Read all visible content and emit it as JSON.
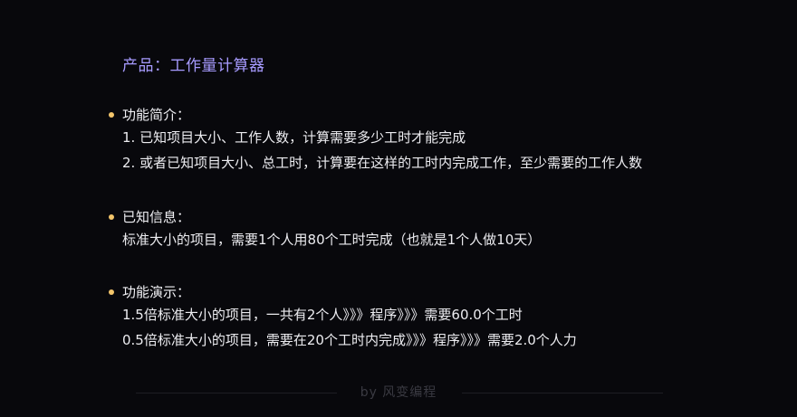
{
  "title": "产品：工作量计算器",
  "sections": [
    {
      "heading": "功能简介：",
      "lines": [
        "1. 已知项目大小、工作人数，计算需要多少工时才能完成",
        "2. 或者已知项目大小、总工时，计算要在这样的工时内完成工作，至少需要的工作人数"
      ]
    },
    {
      "heading": "已知信息：",
      "lines": [
        "标准大小的项目，需要1个人用80个工时完成（也就是1个人做10天）"
      ]
    },
    {
      "heading": "功能演示：",
      "lines": [
        "1.5倍标准大小的项目，一共有2个人》》》程序》》》需要60.0个工时",
        "0.5倍标准大小的项目，需要在20个工时内完成》》》程序》》》需要2.0个人力"
      ]
    }
  ],
  "footer": "by 风变编程",
  "colors": {
    "background": "#08080c",
    "title": "#a79bff",
    "bullet": "#f3c56b",
    "text": "#ececf0"
  }
}
